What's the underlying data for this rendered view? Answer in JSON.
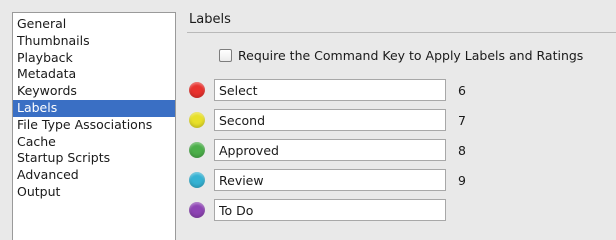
{
  "sidebar": {
    "items": [
      {
        "label": "General"
      },
      {
        "label": "Thumbnails"
      },
      {
        "label": "Playback"
      },
      {
        "label": "Metadata"
      },
      {
        "label": "Keywords"
      },
      {
        "label": "Labels"
      },
      {
        "label": "File Type Associations"
      },
      {
        "label": "Cache"
      },
      {
        "label": "Startup Scripts"
      },
      {
        "label": "Advanced"
      },
      {
        "label": "Output"
      }
    ],
    "selected": "Labels",
    "selected_color": "#3a6fc4"
  },
  "panel": {
    "title": "Labels",
    "require_command_key": {
      "label": "Require the Command Key to Apply Labels and Ratings",
      "checked": false
    },
    "labels": [
      {
        "name": "Select",
        "shortcut": "6",
        "color": "#e8322e",
        "color_name": "red"
      },
      {
        "name": "Second",
        "shortcut": "7",
        "color": "#e8e02a",
        "color_name": "yellow"
      },
      {
        "name": "Approved",
        "shortcut": "8",
        "color": "#4caf4a",
        "color_name": "green"
      },
      {
        "name": "Review",
        "shortcut": "9",
        "color": "#35b2d3",
        "color_name": "blue"
      },
      {
        "name": "To Do",
        "shortcut": "",
        "color": "#8e44b4",
        "color_name": "purple"
      }
    ]
  }
}
